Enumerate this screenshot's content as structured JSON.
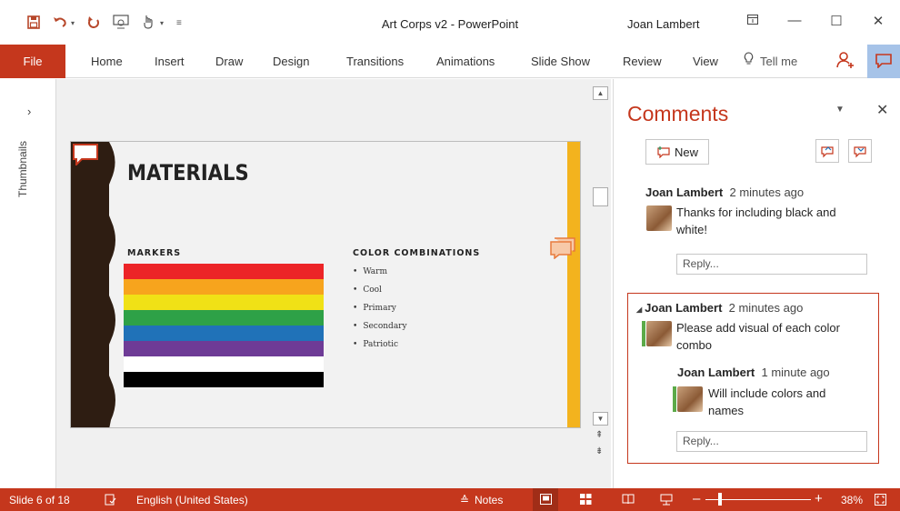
{
  "window": {
    "title": "Art Corps v2 - PowerPoint",
    "user": "Joan Lambert",
    "qat": {
      "save": "save-icon",
      "undo": "undo-icon",
      "redo": "redo-icon",
      "presenter": "presenter-icon",
      "touch": "touch-mode-icon",
      "customize": "customize-qat-icon"
    },
    "controls": {
      "ribbon_display": "⊤",
      "minimize": "—",
      "maximize": "☐",
      "close": "✕"
    }
  },
  "ribbon": {
    "file": "File",
    "tabs": [
      "Home",
      "Insert",
      "Draw",
      "Design",
      "Transitions",
      "Animations",
      "Slide Show",
      "Review",
      "View"
    ],
    "tell_me": "Tell me"
  },
  "thumbnails": {
    "label": "Thumbnails",
    "expand": "›"
  },
  "slide": {
    "title": "MATERIALS",
    "markers_heading": "MARKERS",
    "combos_heading": "COLOR COMBINATIONS",
    "combos": [
      "Warm",
      "Cool",
      "Primary",
      "Secondary",
      "Patriotic"
    ],
    "stripe_colors": [
      "#ec2427",
      "#f7a41d",
      "#f0e116",
      "#2ea147",
      "#2072b8",
      "#6e3b96",
      "#ffffff",
      "#000000"
    ],
    "accent": "#f3b31e",
    "dark": "#2e1d12"
  },
  "pane": {
    "title": "Comments",
    "new_label": "New",
    "comments": [
      {
        "author": "Joan Lambert",
        "time": "2 minutes ago",
        "text_l1": "Thanks for including black and",
        "text_l2": "white!",
        "reply": "Reply..."
      },
      {
        "author": "Joan Lambert",
        "time": "2 minutes ago",
        "text_l1": "Please add visual of each color",
        "text_l2": "combo",
        "sub": {
          "author": "Joan Lambert",
          "time": "1 minute ago",
          "text_l1": "Will include colors and",
          "text_l2": "names"
        },
        "reply": "Reply..."
      }
    ]
  },
  "status": {
    "slide": "Slide 6 of 18",
    "language": "English (United States)",
    "notes": "Notes",
    "zoom": "38%",
    "zoom_fraction": 0.38
  },
  "colors": {
    "brand": "#c5371d",
    "selected_toggle": "#a6c3e8"
  }
}
